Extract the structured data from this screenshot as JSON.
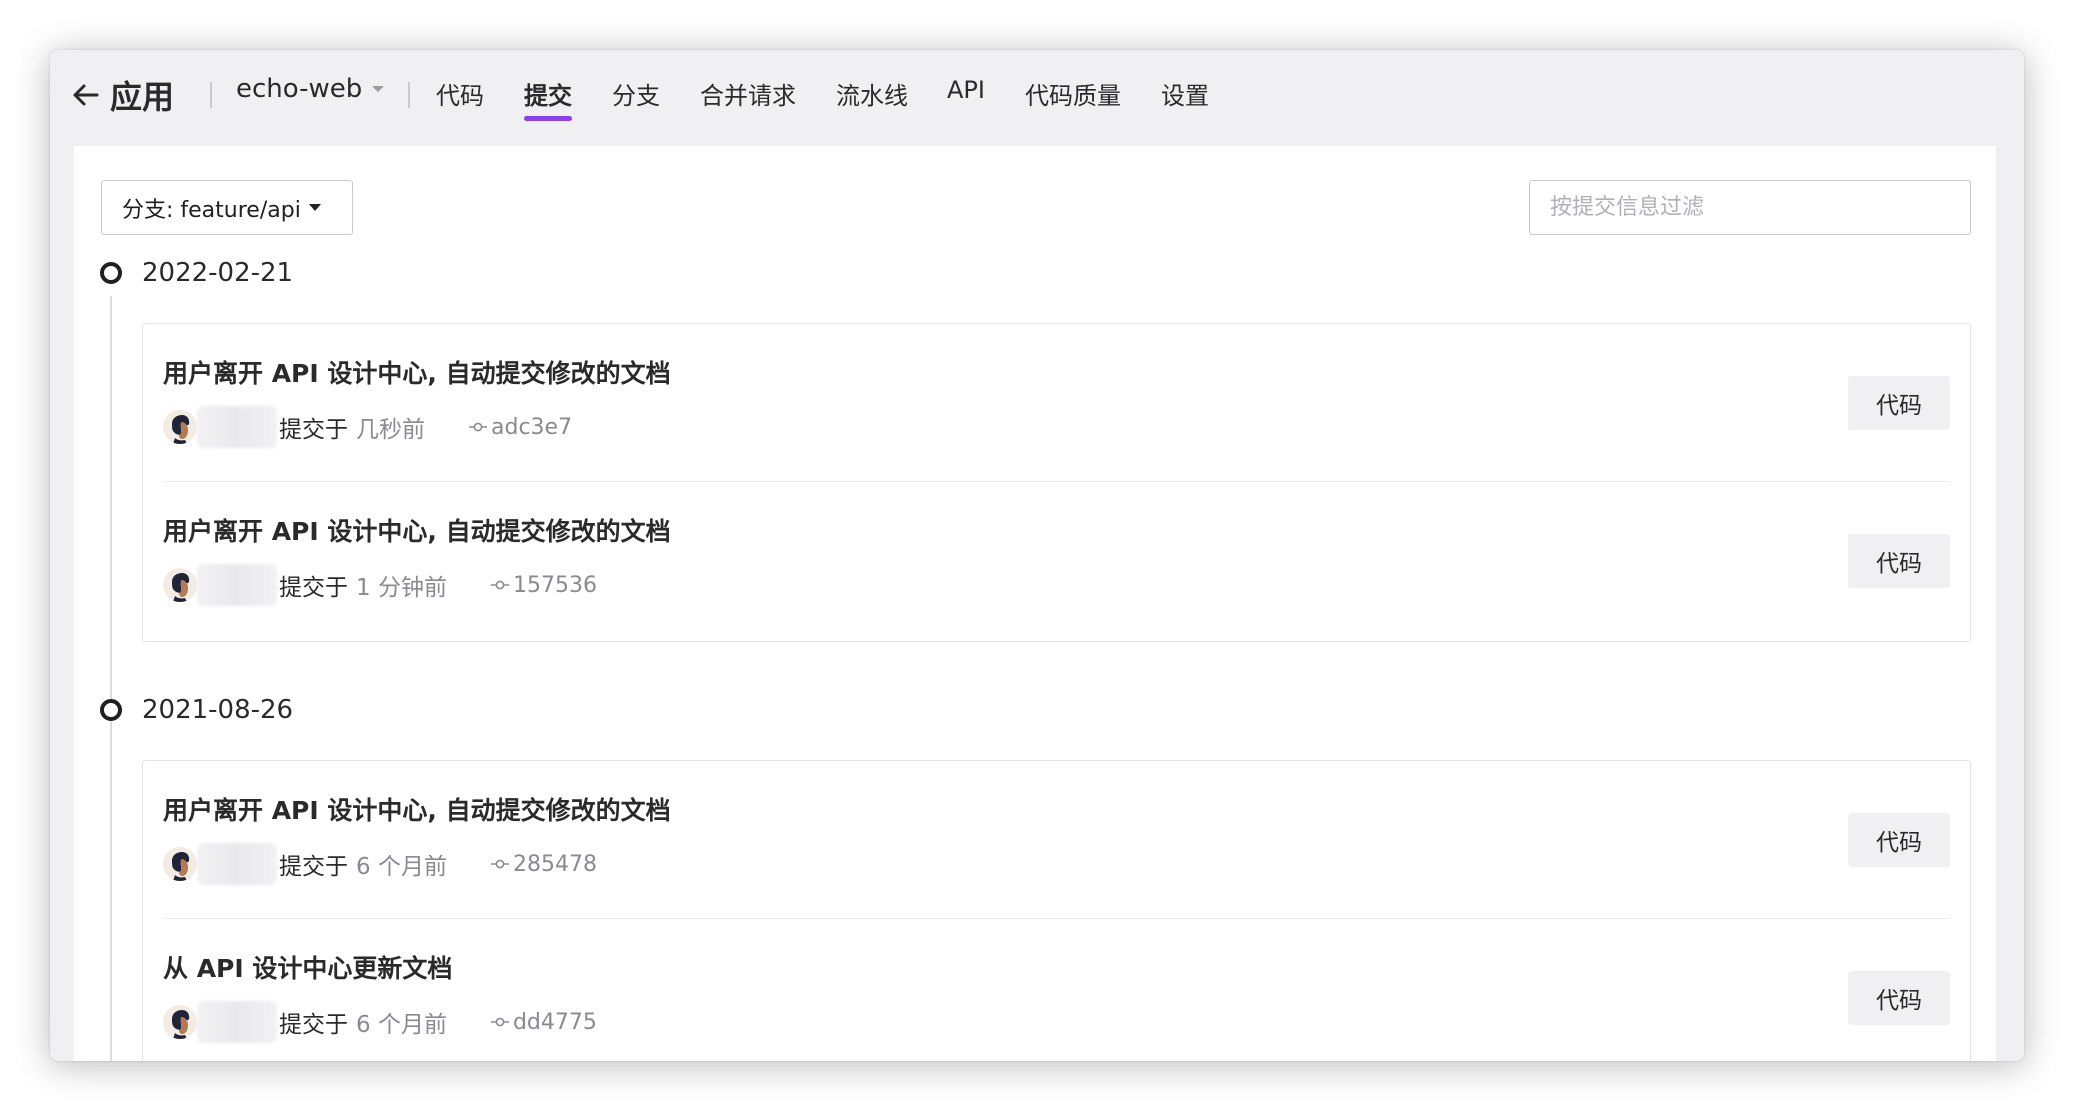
{
  "nav": {
    "back_label": "应用",
    "repo_name": "echo-web",
    "tabs": [
      {
        "label": "代码"
      },
      {
        "label": "提交"
      },
      {
        "label": "分支"
      },
      {
        "label": "合并请求"
      },
      {
        "label": "流水线"
      },
      {
        "label": "API"
      },
      {
        "label": "代码质量"
      },
      {
        "label": "设置"
      }
    ],
    "active_tab": "提交",
    "accent_color": "#8a3ff0"
  },
  "toolbar": {
    "branch_label": "分支: feature/api",
    "filter_placeholder": "按提交信息过滤",
    "filter_value": ""
  },
  "groups": [
    {
      "date": "2022-02-21",
      "commits": [
        {
          "title": "用户离开 API 设计中心, 自动提交修改的文档",
          "verb": "提交于",
          "time": "几秒前",
          "sha": "adc3e7",
          "button": "代码"
        },
        {
          "title": "用户离开 API 设计中心, 自动提交修改的文档",
          "verb": "提交于",
          "time": "1 分钟前",
          "sha": "157536",
          "button": "代码"
        }
      ]
    },
    {
      "date": "2021-08-26",
      "commits": [
        {
          "title": "用户离开 API 设计中心, 自动提交修改的文档",
          "verb": "提交于",
          "time": "6 个月前",
          "sha": "285478",
          "button": "代码"
        },
        {
          "title": "从 API 设计中心更新文档",
          "verb": "提交于",
          "time": "6 个月前",
          "sha": "dd4775",
          "button": "代码"
        }
      ]
    }
  ]
}
